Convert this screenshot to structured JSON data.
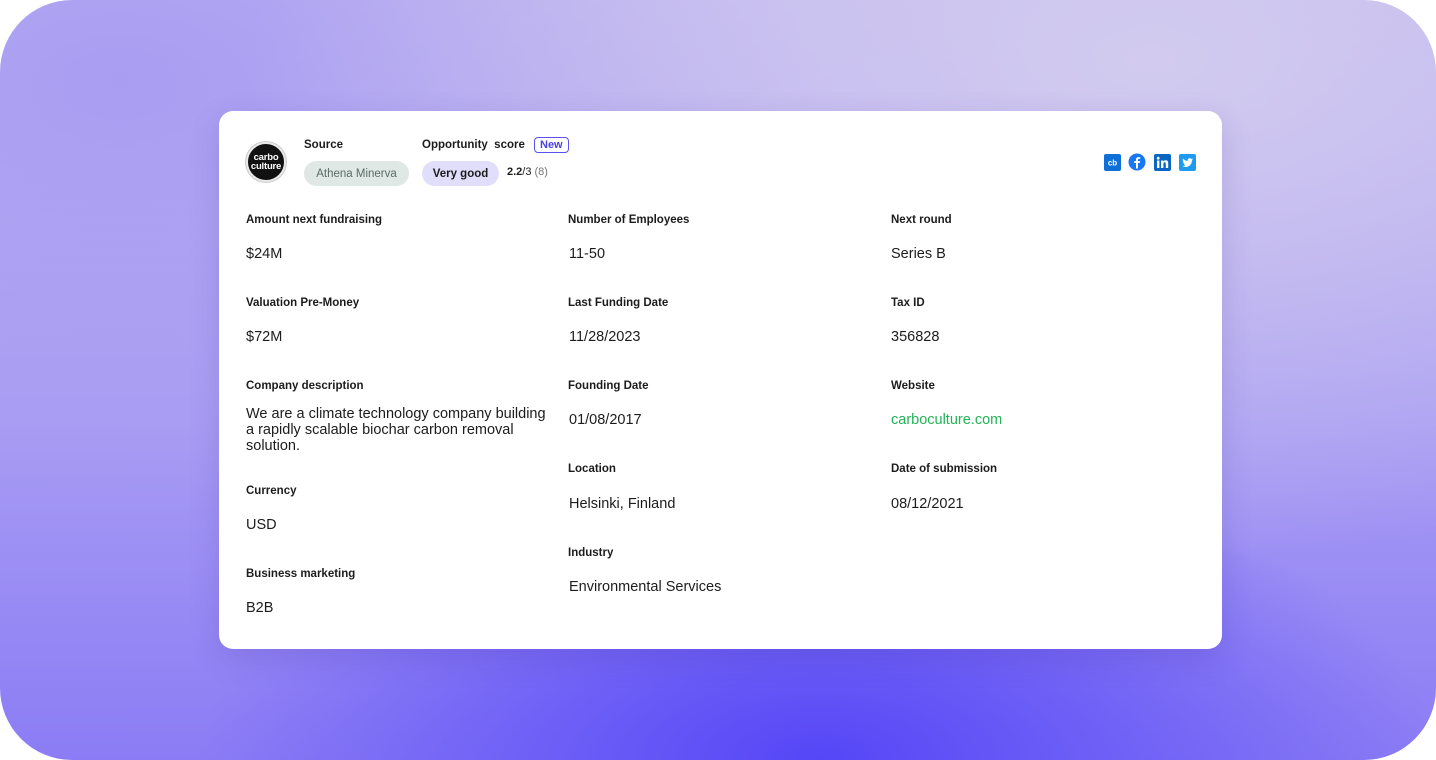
{
  "company": {
    "logo_text_line1": "carbo",
    "logo_text_line2": "culture"
  },
  "header": {
    "source_label": "Source",
    "source_value": "Athena Minerva",
    "score_label": "Opportunity  score",
    "new_badge": "New",
    "score_rating": "Very good",
    "score_value": "2.2",
    "score_max": "/3",
    "score_count": "(8)"
  },
  "socials": [
    {
      "name": "crunchbase-icon",
      "label": "cb",
      "color": "#0e6fd6"
    },
    {
      "name": "facebook-icon",
      "color": "#1877f2"
    },
    {
      "name": "linkedin-icon",
      "color": "#0a66c2"
    },
    {
      "name": "twitter-icon",
      "color": "#1d9bf0"
    }
  ],
  "fields": {
    "amount_next_fundraising": {
      "label": "Amount next fundraising",
      "value": "$24M"
    },
    "valuation_pre_money": {
      "label": "Valuation Pre-Money",
      "value": "$72M"
    },
    "company_description": {
      "label": "Company description",
      "value": "We are a climate technology company building a rapidly scalable biochar carbon removal solution."
    },
    "currency": {
      "label": "Currency",
      "value": "USD"
    },
    "business_marketing": {
      "label": "Business marketing",
      "value": "B2B"
    },
    "number_of_employees": {
      "label": "Number of Employees",
      "value": "11-50"
    },
    "last_funding_date": {
      "label": "Last Funding Date",
      "value": "11/28/2023"
    },
    "founding_date": {
      "label": "Founding Date",
      "value": "01/08/2017"
    },
    "location": {
      "label": "Location",
      "value": "Helsinki, Finland"
    },
    "industry": {
      "label": "Industry",
      "value": "Environmental Services"
    },
    "next_round": {
      "label": "Next round",
      "value": "Series B"
    },
    "tax_id": {
      "label": "Tax ID",
      "value": "356828"
    },
    "website": {
      "label": "Website",
      "value": "carboculture.com"
    },
    "date_of_submission": {
      "label": "Date of submission",
      "value": "08/12/2021"
    }
  },
  "colors": {
    "accent": "#5b4ff0",
    "link": "#22b357"
  }
}
